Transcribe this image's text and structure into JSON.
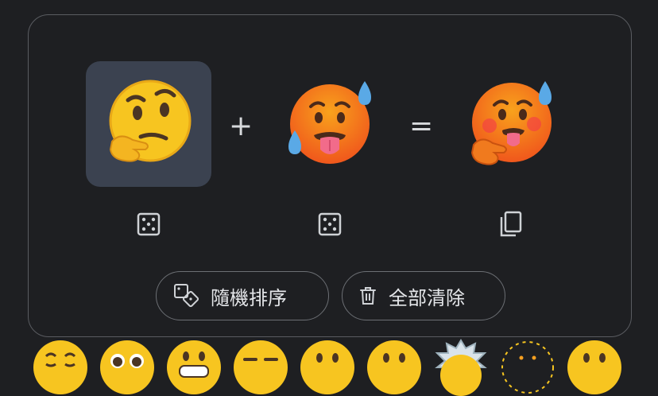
{
  "mixer": {
    "first_emoji": "thinking-face",
    "second_emoji": "hot-face",
    "result_emoji": "thinking-hot-face-mashup",
    "plus_symbol": "+",
    "equals_symbol": "="
  },
  "actions": {
    "shuffle_label": "隨機排序",
    "clear_label": "全部清除"
  },
  "emoji_row": [
    "relieved-face",
    "pleading-face",
    "grimacing-face",
    "expressionless-face",
    "face-without-mouth",
    "neutral-face",
    "exploding-head",
    "dotted-line-face",
    "zipper-mouth-face"
  ],
  "colors": {
    "background": "#1e1f22",
    "card_border": "#5a5c61",
    "selected_slot": "#3b4250",
    "text": "#e4e6e9"
  }
}
